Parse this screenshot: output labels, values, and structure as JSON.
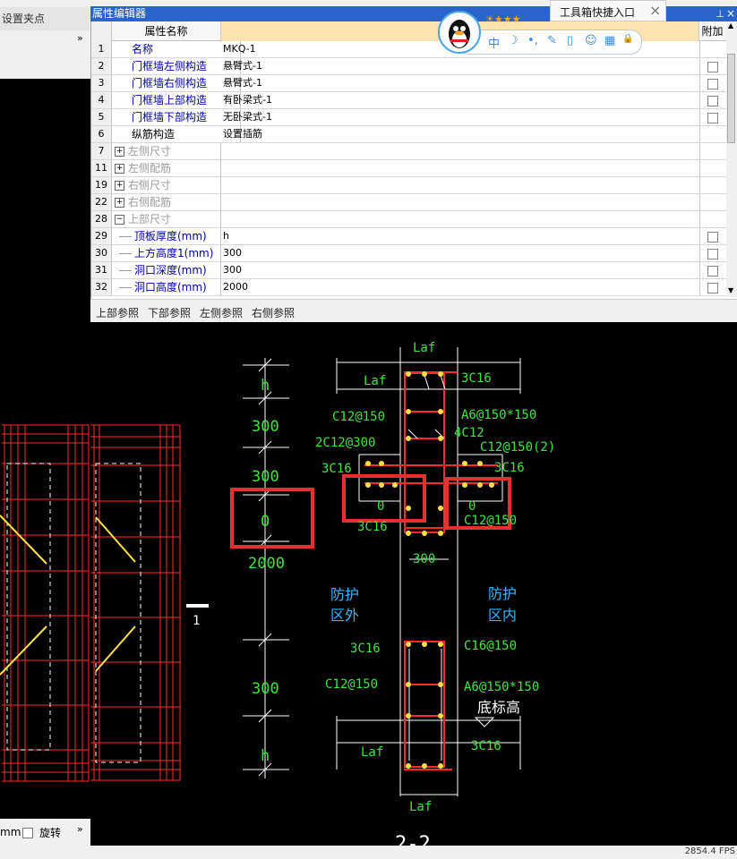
{
  "left_panel": {
    "snap_label": "设置夹点",
    "more_top": "»",
    "unit_label": "mm",
    "rotate_label": "旋转",
    "more_bottom": "»"
  },
  "property_editor": {
    "title": "属性编辑器",
    "pin_icon": "pin-icon",
    "close_label": "×",
    "col_name": "属性名称",
    "col_add": "附加",
    "rows": [
      {
        "num": "1",
        "name": "名称",
        "value": "MKQ-1",
        "style": "normal",
        "check": false,
        "expander": ""
      },
      {
        "num": "2",
        "name": "门框墙左侧构造",
        "value": "悬臂式-1",
        "style": "normal",
        "check": true,
        "expander": ""
      },
      {
        "num": "3",
        "name": "门框墙右侧构造",
        "value": "悬臂式-1",
        "style": "normal",
        "check": true,
        "expander": ""
      },
      {
        "num": "4",
        "name": "门框墙上部构造",
        "value": "有卧梁式-1",
        "style": "normal",
        "check": true,
        "expander": ""
      },
      {
        "num": "5",
        "name": "门框墙下部构造",
        "value": "无卧梁式-1",
        "style": "normal",
        "check": true,
        "expander": ""
      },
      {
        "num": "6",
        "name": "纵筋构造",
        "value": "设置插筋",
        "style": "black",
        "check": false,
        "expander": ""
      },
      {
        "num": "7",
        "name": "左侧尺寸",
        "value": "",
        "style": "grey",
        "check": false,
        "expander": "+"
      },
      {
        "num": "11",
        "name": "左侧配筋",
        "value": "",
        "style": "grey",
        "check": false,
        "expander": "+"
      },
      {
        "num": "19",
        "name": "右侧尺寸",
        "value": "",
        "style": "grey",
        "check": false,
        "expander": "+"
      },
      {
        "num": "22",
        "name": "右侧配筋",
        "value": "",
        "style": "grey",
        "check": false,
        "expander": "+"
      },
      {
        "num": "28",
        "name": "上部尺寸",
        "value": "",
        "style": "grey",
        "check": false,
        "expander": "−"
      },
      {
        "num": "29",
        "name": "顶板厚度(mm)",
        "value": "h",
        "style": "child",
        "check": true,
        "expander": ""
      },
      {
        "num": "30",
        "name": "上方高度1(mm)",
        "value": "300",
        "style": "child",
        "check": true,
        "expander": ""
      },
      {
        "num": "31",
        "name": "洞口深度(mm)",
        "value": "300",
        "style": "child",
        "check": true,
        "expander": ""
      },
      {
        "num": "32",
        "name": "洞口高度(mm)",
        "value": "2000",
        "style": "child",
        "check": true,
        "expander": ""
      }
    ]
  },
  "reference_bar": {
    "top": "上部参照",
    "bottom": "下部参照",
    "left": "左侧参照",
    "right": "右侧参照"
  },
  "qq_widget": {
    "toolbox_label": "工具箱快捷入口",
    "close_label": "×",
    "icons": [
      "中",
      "☽",
      "•,",
      "✎",
      "▯",
      "☺",
      "▦",
      "🔒"
    ]
  },
  "drawing": {
    "elev": {
      "h_top": "h",
      "d300a": "300",
      "d300b": "300",
      "d0": "0",
      "d2000": "2000",
      "d300c": "300",
      "h_bot": "h"
    },
    "section_mark": "1",
    "labels": {
      "laf_top": "Laf",
      "laf_left": "Laf",
      "c16_3_top": "3C16",
      "c12_150_top": "C12@150",
      "a6_top": "A6@150*150",
      "c12_4": "4C12",
      "c12_2_300": "2C12@300",
      "c12_150_2": "C12@150(2)",
      "c16_3_l": "3C16",
      "c16_3_r": "3C16",
      "zero_l": "0",
      "zero_r": "0",
      "c16_3_under": "3C16",
      "c12_150_r": "C12@150",
      "d300_mid": "300",
      "out_1": "防护",
      "out_2": "区外",
      "in_1": "防护",
      "in_2": "区内",
      "c16_3_b": "3C16",
      "c16_150": "C16@150",
      "c12_150_b": "C12@150",
      "a6_b": "A6@150*150",
      "base": "底标高",
      "laf_bl": "Laf",
      "c16_3_br": "3C16",
      "laf_bottom": "Laf",
      "section_title": "2-2"
    }
  },
  "status": {
    "fps": "2854.4 FPS"
  }
}
